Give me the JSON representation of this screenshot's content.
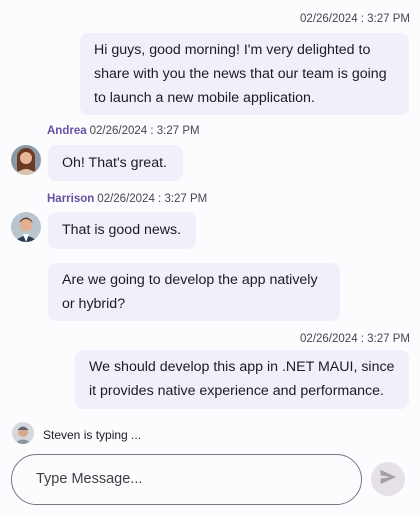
{
  "messages": [
    {
      "time": "02/26/2024 : 3:27 PM",
      "text_lines": [
        "Hi guys, good morning! I'm very delighted to",
        "share with you the news that our team is going",
        "to launch a new mobile application."
      ]
    },
    {
      "author": "Andrea",
      "time": "02/26/2024 : 3:27 PM",
      "text": "Oh! That's great."
    },
    {
      "author": "Harrison",
      "time": "02/26/2024 : 3:27 PM",
      "text": "That is good news."
    },
    {
      "text_lines": [
        "Are we going to develop the app natively",
        "or hybrid?"
      ]
    },
    {
      "time": "02/26/2024 : 3:27 PM",
      "text_lines": [
        "We should develop this app in .NET MAUI, since",
        "it provides native experience and performance."
      ]
    }
  ],
  "typing_indicator": {
    "text": "Steven is typing ..."
  },
  "composer": {
    "placeholder": "Type Message..."
  },
  "icons": {
    "avatar_andrea": "avatar-andrea-icon",
    "avatar_harrison": "avatar-harrison-icon",
    "avatar_steven": "avatar-steven-icon",
    "send": "send-icon"
  },
  "colors": {
    "background": "#fcfbfd",
    "bubble": "#f3effa",
    "author_name": "#6750a4",
    "send_button": "#e6e1e9"
  }
}
